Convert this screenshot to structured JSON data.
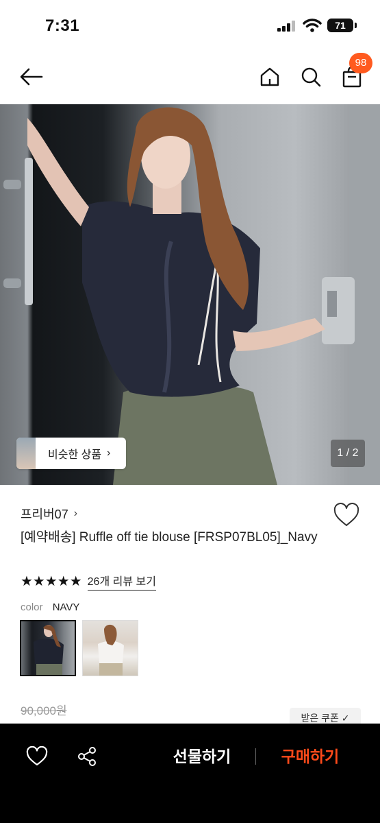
{
  "status_bar": {
    "time": "7:31",
    "battery": "71"
  },
  "header": {
    "cart_count": "98"
  },
  "hero": {
    "similar_label": "비슷한 상품",
    "page_indicator": "1 / 2"
  },
  "product": {
    "brand": "프리버07",
    "title": "[예약배송] Ruffle off tie blouse [FRSP07BL05]_Navy",
    "rating_stars": "★★★★★",
    "review_link": "26개 리뷰 보기",
    "color_label": "color",
    "color_value": "NAVY",
    "original_price": "90,000원",
    "coupon_label": "받은 쿠폰 ✓"
  },
  "bottom_bar": {
    "gift_label": "선물하기",
    "buy_label": "구매하기"
  },
  "colors": {
    "accent": "#ff5a1f",
    "buy": "#ff4a1a"
  },
  "icons": [
    "back-arrow-icon",
    "home-icon",
    "search-icon",
    "shopping-bag-icon",
    "heart-icon",
    "share-icon",
    "chevron-right-icon"
  ]
}
